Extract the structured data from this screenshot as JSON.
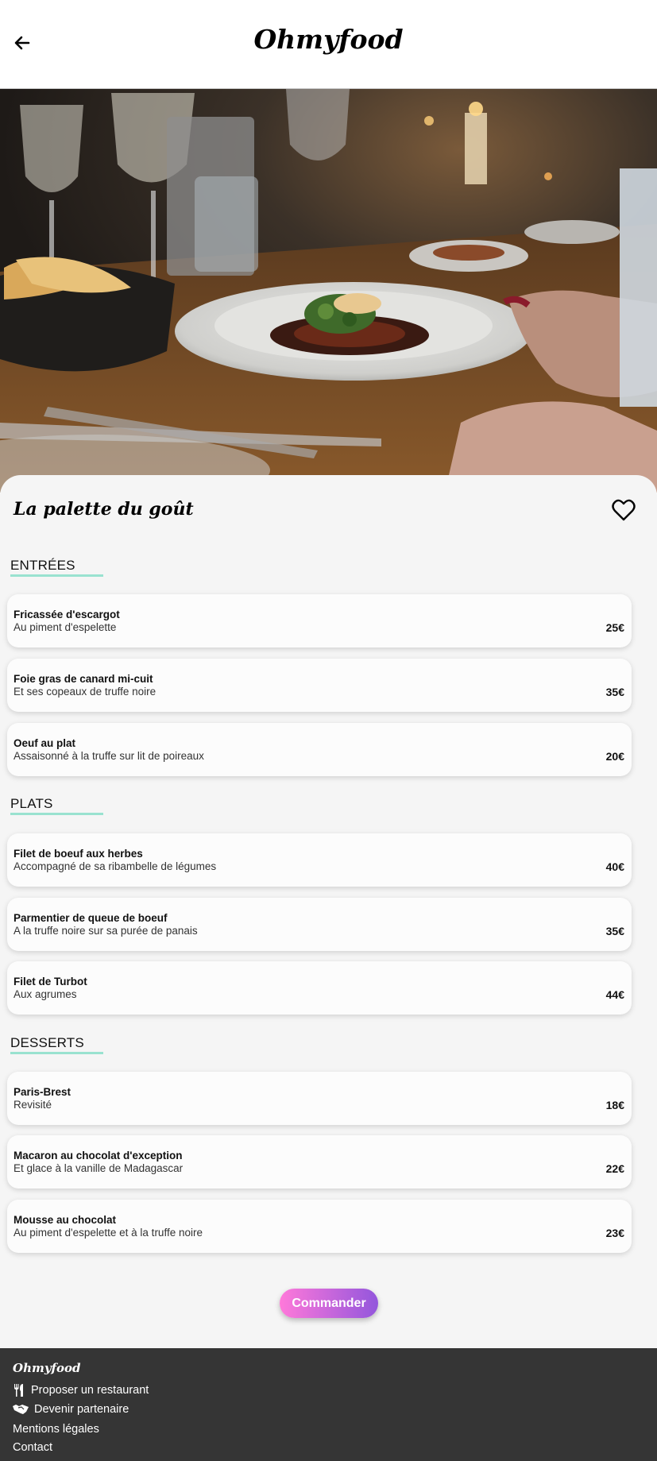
{
  "header": {
    "back_icon": "arrow-left-icon",
    "logo": "Ohmyfood"
  },
  "hero": {
    "image": "restaurant-table-photo"
  },
  "restaurant": {
    "name": "La palette du goût",
    "favorite_icon": "heart-outline-icon"
  },
  "sections": [
    {
      "title": "ENTRÉES",
      "items": [
        {
          "name": "Fricassée d'escargot",
          "description": "Au piment d'espelette",
          "price": "25€"
        },
        {
          "name": "Foie gras de canard mi-cuit",
          "description": "Et ses copeaux de truffe noire",
          "price": "35€"
        },
        {
          "name": "Oeuf au plat",
          "description": "Assaisonné à la truffe sur lit de poireaux",
          "price": "20€"
        }
      ]
    },
    {
      "title": "PLATS",
      "items": [
        {
          "name": "Filet de boeuf aux herbes",
          "description": "Accompagné de sa ribambelle de légumes",
          "price": "40€"
        },
        {
          "name": "Parmentier de queue de boeuf",
          "description": "A la truffe noire sur sa purée de panais",
          "price": "35€"
        },
        {
          "name": "Filet de Turbot",
          "description": "Aux agrumes",
          "price": "44€"
        }
      ]
    },
    {
      "title": "DESSERTS",
      "items": [
        {
          "name": "Paris-Brest",
          "description": "Revisité",
          "price": "18€"
        },
        {
          "name": "Macaron au chocolat d'exception",
          "description": "Et glace à la vanille de Madagascar",
          "price": "22€"
        },
        {
          "name": "Mousse au chocolat",
          "description": "Au piment d'espelette et à la truffe noire",
          "price": "23€"
        }
      ]
    }
  ],
  "order_button": "Commander",
  "footer": {
    "logo": "Ohmyfood",
    "links": [
      {
        "label": "Proposer un restaurant",
        "icon": "utensils-icon"
      },
      {
        "label": "Devenir partenaire",
        "icon": "handshake-icon"
      },
      {
        "label": "Mentions légales"
      },
      {
        "label": "Contact"
      }
    ]
  },
  "colors": {
    "accent_underline": "#99e2d0",
    "button_gradient_start": "#ff79da",
    "button_gradient_end": "#9356dc",
    "footer_bg": "#353535",
    "panel_bg": "#f5f5f5"
  }
}
